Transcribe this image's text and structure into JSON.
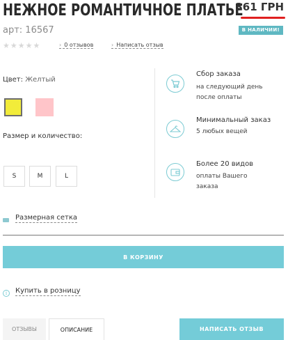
{
  "product": {
    "title": "НЕЖНОЕ РОМАНТИЧНОЕ ПЛАТЬЕ",
    "price": "361 ГРН",
    "sku": "арт: 16567",
    "stock": "В НАЛИЧИИ!",
    "rating_stars": "★★★★★",
    "rating_value": 0,
    "reviews_link": "0 отзывов",
    "write_review_link": "Написать отзыв",
    "chevron": "›"
  },
  "options": {
    "color_label": "Цвет:",
    "color_value": "Желтый",
    "colors": [
      "#f2ec3a",
      "#ffc5c9"
    ],
    "size_label": "Размер и количество:",
    "sizes": [
      "S",
      "M",
      "L"
    ]
  },
  "features": [
    {
      "title": "Сбор заказа",
      "sub1": "на следующий день",
      "sub2": "после оплаты",
      "icon": "cart-icon"
    },
    {
      "title": "Минимальный заказ",
      "sub1": "5 любых вещей",
      "sub2": "",
      "icon": "hanger-icon"
    },
    {
      "title": "Более 20 видов",
      "sub1": "оплаты Вашего",
      "sub2": "заказа",
      "icon": "wallet-icon"
    }
  ],
  "size_chart_link": "Размерная сетка",
  "cart_button": "В КОРЗИНУ",
  "retail_link": "Купить в розницу",
  "info_glyph": "i",
  "tabs": {
    "reviews": "ОТЗЫВЫ",
    "description": "ОПИСАНИЕ"
  },
  "write_review_button": "НАПИСАТЬ ОТЗЫВ",
  "colors": {
    "accent": "#74ccd8",
    "price_underline": "#e02020"
  }
}
